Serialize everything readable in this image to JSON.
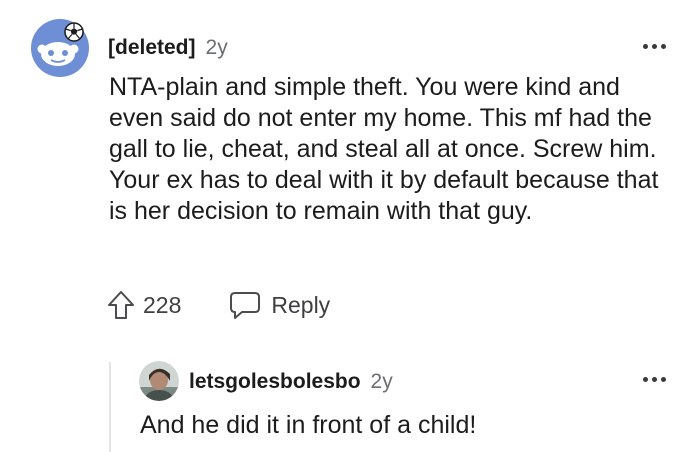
{
  "comment": {
    "username": "[deleted]",
    "age": "2y",
    "body": "NTA-plain and simple theft. You were kind and even said do not enter my home. This mf had the gall to lie, cheat, and steal all at once. Screw him. Your ex has to deal with it by default because that is her decision to remain with that guy.",
    "upvotes": "228",
    "reply_label": "Reply",
    "avatar_icon": "snoo-avatar-icon",
    "more_icon": "more-options-icon"
  },
  "reply": {
    "username": "letsgolesbolesbo",
    "age": "2y",
    "body": "And he did it in front of a child!",
    "avatar_icon": "user-photo-avatar-icon",
    "more_icon": "more-options-icon"
  },
  "colors": {
    "text": "#1c1c1c",
    "muted": "#6b6f71",
    "avatar_bg": "#6e8ed6",
    "thread_line": "#e2e4e5"
  }
}
